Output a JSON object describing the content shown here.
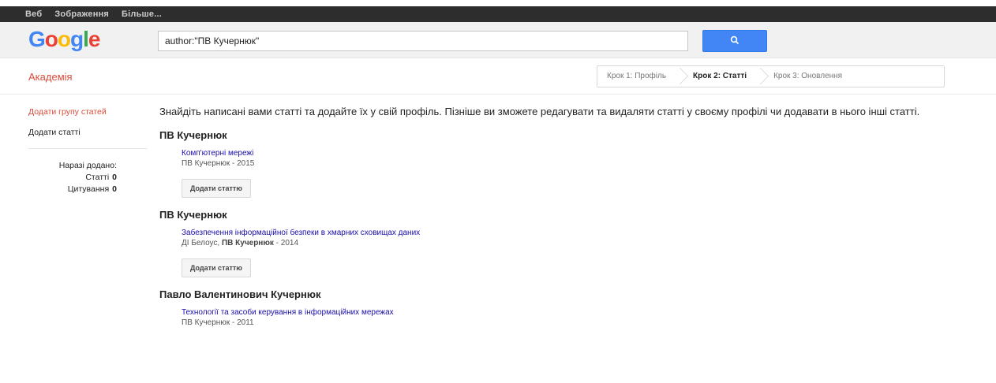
{
  "top_nav": [
    "Веб",
    "Зображення",
    "Більше..."
  ],
  "search": {
    "value": "author:\"ПВ Кучернюк\"",
    "button_icon": "search-icon"
  },
  "subheader": {
    "title": "Академія",
    "steps": [
      {
        "label": "Крок 1: Профіль",
        "active": false
      },
      {
        "label": "Крок 2: Статті",
        "active": true
      },
      {
        "label": "Крок 3: Оновлення",
        "active": false
      }
    ]
  },
  "sidebar": {
    "add_group": "Додати групу статей",
    "add_articles": "Додати статті",
    "stats_label": "Наразі додано:",
    "articles_label": "Статті",
    "articles_count": "0",
    "citations_label": "Цитування",
    "citations_count": "0"
  },
  "intro": "Знайдіть написані вами статті та додайте їх у свій профіль. Пізніше ви зможете редагувати та видаляти статті у своєму профілі чи додавати в нього інші статті.",
  "add_button_label": "Додати статтю",
  "groups": [
    {
      "author": "ПВ Кучернюк",
      "title": "Комп'ютерні мережі",
      "meta_prefix": "",
      "meta_bold": "",
      "meta_rest": "ПВ Кучернюк - 2015",
      "has_button": true
    },
    {
      "author": "ПВ Кучернюк",
      "title": "Забезпечення інформаційної безпеки в хмарних сховищах даних",
      "meta_prefix": "ДІ Белоус, ",
      "meta_bold": "ПВ Кучернюк",
      "meta_rest": " - 2014",
      "has_button": true
    },
    {
      "author": "Павло Валентинович Кучернюк",
      "title": "Технології та засоби керування в інформаційних мережах",
      "meta_prefix": "",
      "meta_bold": "",
      "meta_rest": "ПВ Кучернюк - 2011",
      "has_button": false
    }
  ]
}
